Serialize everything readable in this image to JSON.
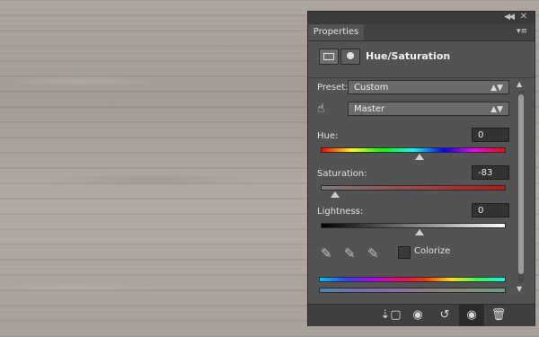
{
  "panel": {
    "tab_label": "Properties",
    "title": "Hue/Saturation",
    "preset": {
      "label": "Preset:",
      "value": "Custom"
    },
    "channel": {
      "value": "Master"
    },
    "hue": {
      "label": "Hue:",
      "value": "0",
      "position": 0.5
    },
    "saturation": {
      "label": "Saturation:",
      "value": "-83",
      "position": 0.085
    },
    "lightness": {
      "label": "Lightness:",
      "value": "0",
      "position": 0.5
    },
    "colorize": {
      "label": "Colorize",
      "checked": false
    }
  },
  "icons": {
    "collapse": "double-chevron-left",
    "close": "close",
    "menu": "panel-menu",
    "adjustment": "adjustment-layer",
    "mask": "layer-mask",
    "targeted_adjustment": "hand-target",
    "eyedroppers": [
      "eyedropper",
      "eyedropper-plus",
      "eyedropper-minus"
    ],
    "bottom": [
      "clip-to-layer",
      "view-previous-state",
      "reset",
      "toggle-visibility",
      "delete"
    ]
  }
}
